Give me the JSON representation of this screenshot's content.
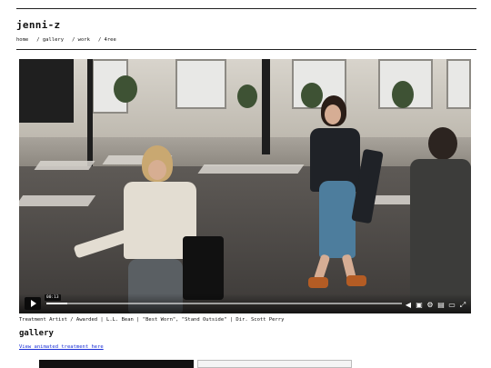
{
  "site": {
    "title": "jenni-z"
  },
  "nav": {
    "items": [
      "home",
      "/ gallery",
      "/ work",
      "/ 4ree"
    ]
  },
  "video": {
    "current_time": "00:13",
    "progress": 0.06,
    "controls": [
      "volume-icon",
      "captions-icon",
      "settings-icon",
      "pip-icon",
      "airplay-icon",
      "fullscreen-icon"
    ]
  },
  "caption": "Treatment Artist / Awarded | L.L. Bean | \"Best Worn\", \"Stand Outside\" | Dir. Scott Perry",
  "section": {
    "title": "gallery"
  },
  "link": {
    "label": "View animated treatment here"
  }
}
